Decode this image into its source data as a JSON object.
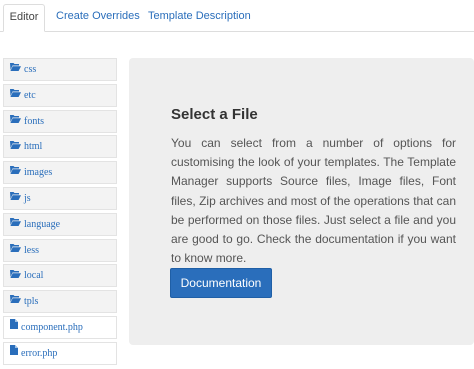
{
  "tabs": {
    "editor": "Editor",
    "overrides": "Create Overrides",
    "description": "Template Description"
  },
  "tree": {
    "items": [
      {
        "label": "css",
        "type": "folder"
      },
      {
        "label": "etc",
        "type": "folder"
      },
      {
        "label": "fonts",
        "type": "folder"
      },
      {
        "label": "html",
        "type": "folder"
      },
      {
        "label": "images",
        "type": "folder"
      },
      {
        "label": "js",
        "type": "folder"
      },
      {
        "label": "language",
        "type": "folder"
      },
      {
        "label": "less",
        "type": "folder"
      },
      {
        "label": "local",
        "type": "folder"
      },
      {
        "label": "tpls",
        "type": "folder"
      },
      {
        "label": "component.php",
        "type": "file"
      },
      {
        "label": "error.php",
        "type": "file"
      }
    ]
  },
  "panel": {
    "title": "Select a File",
    "text": "You can select from a number of options for customising the look of your templates. The Template Manager supports Source files, Image files, Font files, Zip archives and most of the operations that can be performed on those files. Just select a file and you are good to go. Check the documentation if you want to know more.",
    "button_label": "Documentation"
  },
  "colors": {
    "accent": "#2a6ebb",
    "panel_bg": "#eeeeee"
  }
}
